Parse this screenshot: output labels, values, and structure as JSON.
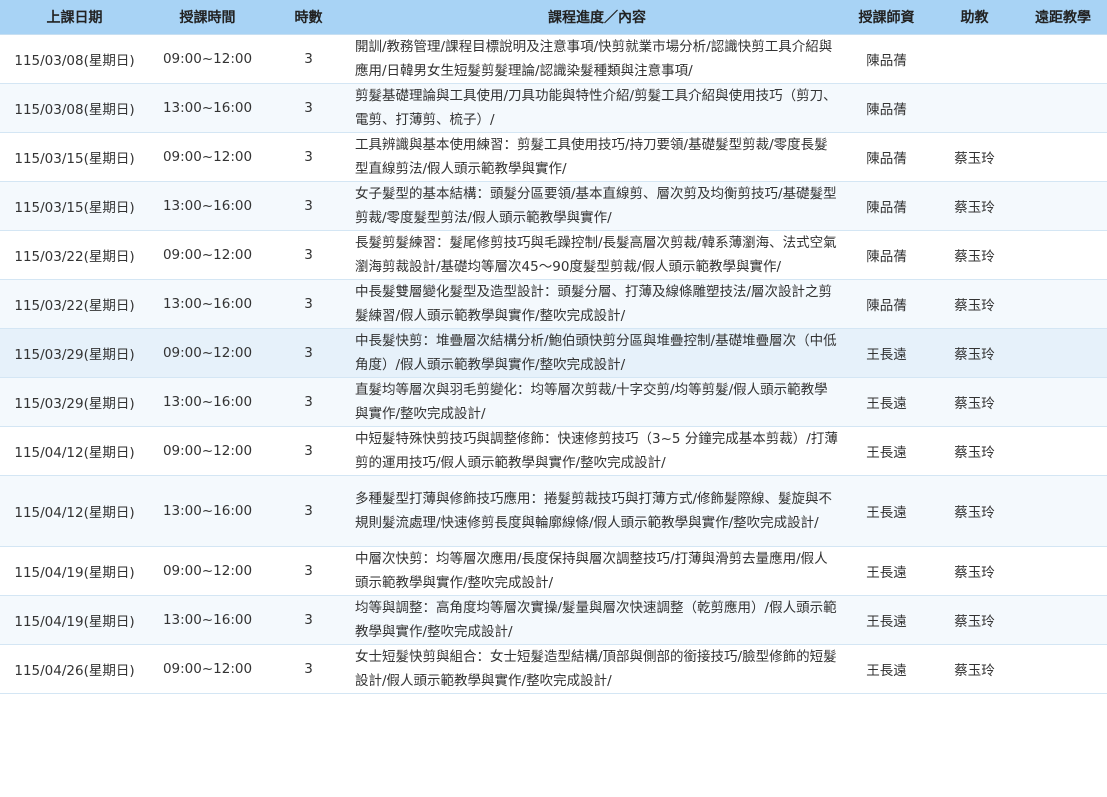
{
  "headers": [
    "上課日期",
    "授課時間",
    "時數",
    "課程進度／內容",
    "授課師資",
    "助教",
    "遠距教學"
  ],
  "rows": [
    {
      "date": "115/03/08(星期日)",
      "time": "09:00~12:00",
      "hours": "3",
      "content": "開訓/教務管理/課程目標說明及注意事項/快剪就業市場分析/認識快剪工具介紹與應用/日韓男女生短髮剪髮理論/認識染髮種類與注意事項/",
      "teacher": "陳品蒨",
      "assistant": "",
      "remote": ""
    },
    {
      "date": "115/03/08(星期日)",
      "time": "13:00~16:00",
      "hours": "3",
      "content": "剪髮基礎理論與工具使用/刀具功能與特性介紹/剪髮工具介紹與使用技巧（剪刀、電剪、打薄剪、梳子）/",
      "teacher": "陳品蒨",
      "assistant": "",
      "remote": ""
    },
    {
      "date": "115/03/15(星期日)",
      "time": "09:00~12:00",
      "hours": "3",
      "content": "工具辨識與基本使用練習：剪髮工具使用技巧/持刀要領/基礎髮型剪裁/零度長髮型直線剪法/假人頭示範教學與實作/",
      "teacher": "陳品蒨",
      "assistant": "蔡玉玲",
      "remote": ""
    },
    {
      "date": "115/03/15(星期日)",
      "time": "13:00~16:00",
      "hours": "3",
      "content": "女子髮型的基本結構：頭髮分區要領/基本直線剪、層次剪及均衡剪技巧/基礎髮型剪裁/零度髮型剪法/假人頭示範教學與實作/",
      "teacher": "陳品蒨",
      "assistant": "蔡玉玲",
      "remote": ""
    },
    {
      "date": "115/03/22(星期日)",
      "time": "09:00~12:00",
      "hours": "3",
      "content": "長髮剪髮練習：髮尾修剪技巧與毛躁控制/長髮高層次剪裁/韓系薄瀏海、法式空氣瀏海剪裁設計/基礎均等層次45～90度髮型剪裁/假人頭示範教學與實作/",
      "teacher": "陳品蒨",
      "assistant": "蔡玉玲",
      "remote": ""
    },
    {
      "date": "115/03/22(星期日)",
      "time": "13:00~16:00",
      "hours": "3",
      "content": "中長髮雙層變化髮型及造型設計：頭髮分層、打薄及線條雕塑技法/層次設計之剪髮練習/假人頭示範教學與實作/整吹完成設計/",
      "teacher": "陳品蒨",
      "assistant": "蔡玉玲",
      "remote": ""
    },
    {
      "date": "115/03/29(星期日)",
      "time": "09:00~12:00",
      "hours": "3",
      "content": "中長髮快剪：堆疊層次結構分析/鮑伯頭快剪分區與堆疊控制/基礎堆疊層次（中低角度）/假人頭示範教學與實作/整吹完成設計/",
      "teacher": "王長遠",
      "assistant": "蔡玉玲",
      "remote": ""
    },
    {
      "date": "115/03/29(星期日)",
      "time": "13:00~16:00",
      "hours": "3",
      "content": "直髮均等層次與羽毛剪變化：均等層次剪裁/十字交剪/均等剪髮/假人頭示範教學與實作/整吹完成設計/",
      "teacher": "王長遠",
      "assistant": "蔡玉玲",
      "remote": ""
    },
    {
      "date": "115/04/12(星期日)",
      "time": "09:00~12:00",
      "hours": "3",
      "content": "中短髮特殊快剪技巧與調整修飾：快速修剪技巧（3~5 分鐘完成基本剪裁）/打薄剪的運用技巧/假人頭示範教學與實作/整吹完成設計/",
      "teacher": "王長遠",
      "assistant": "蔡玉玲",
      "remote": ""
    },
    {
      "date": "115/04/12(星期日)",
      "time": "13:00~16:00",
      "hours": "3",
      "content": "多種髮型打薄與修飾技巧應用：捲髮剪裁技巧與打薄方式/修飾髮際線、髮旋與不規則髮流處理/快速修剪長度與輪廓線條/假人頭示範教學與實作/整吹完成設計/",
      "teacher": "王長遠",
      "assistant": "蔡玉玲",
      "remote": ""
    },
    {
      "date": "115/04/19(星期日)",
      "time": "09:00~12:00",
      "hours": "3",
      "content": "中層次快剪：均等層次應用/長度保持與層次調整技巧/打薄與滑剪去量應用/假人頭示範教學與實作/整吹完成設計/",
      "teacher": "王長遠",
      "assistant": "蔡玉玲",
      "remote": ""
    },
    {
      "date": "115/04/19(星期日)",
      "time": "13:00~16:00",
      "hours": "3",
      "content": "均等與調整：高角度均等層次實操/髮量與層次快速調整（乾剪應用）/假人頭示範教學與實作/整吹完成設計/",
      "teacher": "王長遠",
      "assistant": "蔡玉玲",
      "remote": ""
    },
    {
      "date": "115/04/26(星期日)",
      "time": "09:00~12:00",
      "hours": "3",
      "content": "女士短髮快剪與組合：女士短髮造型結構/頂部與側部的銜接技巧/臉型修飾的短髮設計/假人頭示範教學與實作/整吹完成設計/",
      "teacher": "王長遠",
      "assistant": "蔡玉玲",
      "remote": ""
    }
  ]
}
